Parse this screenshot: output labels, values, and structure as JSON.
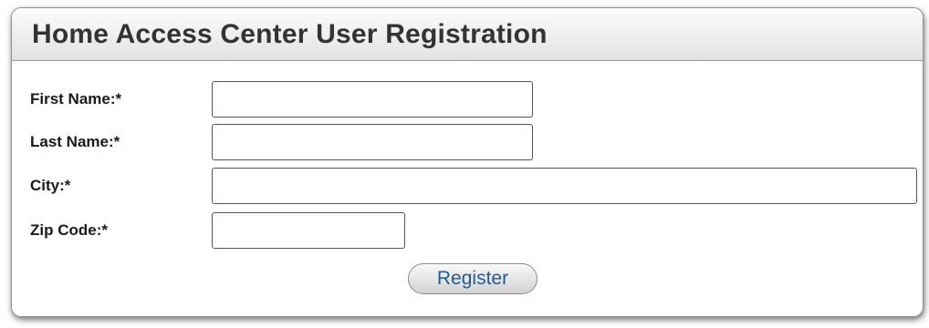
{
  "panel": {
    "title": "Home Access Center User Registration"
  },
  "form": {
    "fields": [
      {
        "label": "First Name:*",
        "value": "",
        "placeholder": ""
      },
      {
        "label": "Last Name:*",
        "value": "",
        "placeholder": ""
      },
      {
        "label": "City:*",
        "value": "",
        "placeholder": ""
      },
      {
        "label": "Zip Code:*",
        "value": "",
        "placeholder": ""
      }
    ],
    "register_label": "Register"
  },
  "colors": {
    "title_text": "#333333",
    "button_text": "#1f5b96",
    "border": "#8f8f8f"
  }
}
